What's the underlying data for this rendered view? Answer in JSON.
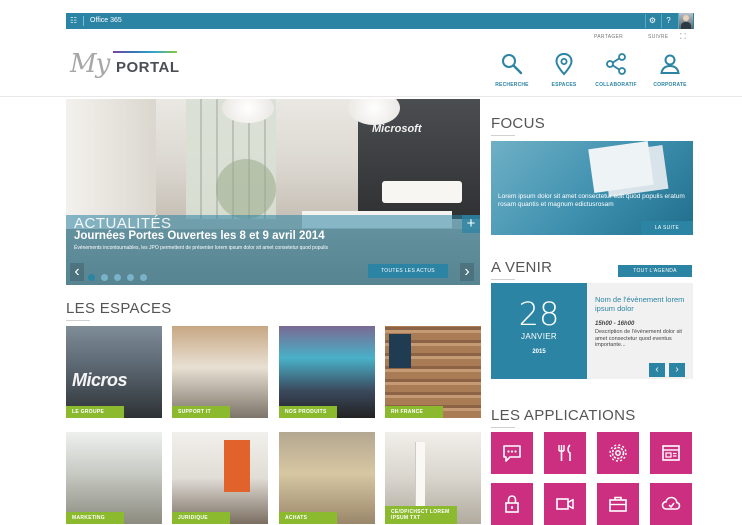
{
  "topbar": {
    "app_label": "Office 365",
    "gear": "⚙",
    "help": "?"
  },
  "header": {
    "share": "PARTAGER",
    "follow": "SUIVRE",
    "expand": "⛶"
  },
  "logo": {
    "my": "My",
    "portal": "PORTAL"
  },
  "nav": [
    {
      "label": "RECHERCHE",
      "icon": "search-icon"
    },
    {
      "label": "ESPACES",
      "icon": "location-pin-icon"
    },
    {
      "label": "COLLABORATIF",
      "icon": "share-icon"
    },
    {
      "label": "CORPORATE",
      "icon": "person-icon"
    }
  ],
  "hero": {
    "brand_sign": "Microsoft",
    "eyebrow": "ACTUALITÉS",
    "title": "Journées Portes Ouvertes les 8 et 9 avril 2014",
    "description": "Événements incontournables, les JPO permettent de présenter lorem ipsum dolor sit amet consetetur quod populis",
    "button": "TOUTES LES ACTUS",
    "plus": "+",
    "prev": "‹",
    "next": "›",
    "slides": 5,
    "active_slide": 1
  },
  "espaces": {
    "title": "LES ESPACES",
    "tile_caption": "Micros",
    "tiles": [
      {
        "label": "LE GROUPE"
      },
      {
        "label": "SUPPORT IT"
      },
      {
        "label": "NOS PRODUITS"
      },
      {
        "label": "RH FRANCE"
      },
      {
        "label": "MARKETING"
      },
      {
        "label": "JURIDIQUE"
      },
      {
        "label": "ACHATS"
      },
      {
        "label": "CE/DP/CHSCT LOREM IPSUM TXT"
      }
    ]
  },
  "focus": {
    "title": "FOCUS",
    "text": "Lorem ipsum dolor sit amet consectetur edit quod populis eratum rosam quantis et magnum edictusrosam",
    "button": "LA SUITE"
  },
  "avenir": {
    "title": "A VENIR",
    "button": "TOUT L'AGENDA",
    "day": "28",
    "month": "JANVIER",
    "year": "2015",
    "event_title": "Nom de l'évènement lorem ipsum dolor",
    "event_time": "15h00 - 16h00",
    "event_desc": "Description de l'évènement dolor sit amet consectetur quod eventus importante...",
    "prev": "‹",
    "next": "›"
  },
  "applications": {
    "title": "LES APPLICATIONS",
    "apps": [
      {
        "icon": "chat-icon"
      },
      {
        "icon": "restaurant-icon"
      },
      {
        "icon": "settings-icon"
      },
      {
        "icon": "browser-window-icon"
      },
      {
        "icon": "lock-icon"
      },
      {
        "icon": "video-camera-icon"
      },
      {
        "icon": "briefcase-icon"
      },
      {
        "icon": "cloud-icon"
      }
    ]
  },
  "colors": {
    "accent": "#2b84a4",
    "tile_label": "#8bba2f",
    "app_tile": "#cc2e80"
  }
}
